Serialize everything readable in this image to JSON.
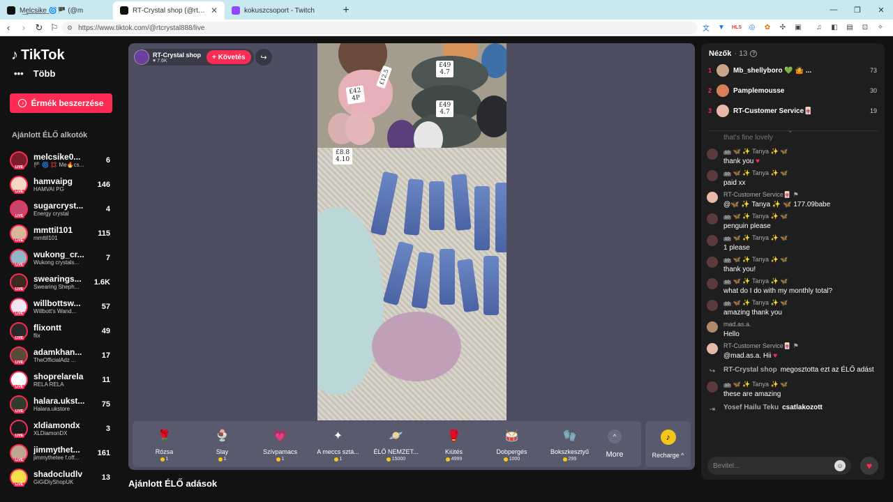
{
  "browser": {
    "tabs": [
      {
        "label": "M͟e͟l͟c͟s͟i͟k͟e͟ 🌀🏴 (@m",
        "color": "#111111",
        "active": false
      },
      {
        "label": "RT-Crystal shop (@rtcrystal88",
        "color": "#111111",
        "active": true
      },
      {
        "label": "kokuszcsoport - Twitch",
        "color": "#9146ff",
        "active": false
      }
    ],
    "new_tab": "+",
    "url": "https://www.tiktok.com/@rtcrystal888/live",
    "win_min": "—",
    "win_max": "❐",
    "win_close": "✕"
  },
  "sidebar": {
    "brand": "TikTok",
    "more_label": "Több",
    "more_icon": "•••",
    "coins_button": "Érmék beszerzése",
    "recommended_title": "Ajánlott ÉLŐ alkotók",
    "live_badge": "LIVE",
    "creators": [
      {
        "name": "melcsike0...",
        "sub": "🏴 🌀 💢 Me🔥cs...",
        "count": "6",
        "color": "#7a1d2e"
      },
      {
        "name": "hamvaipg",
        "sub": "HAMVAI PG",
        "count": "146",
        "color": "#f2d7c4"
      },
      {
        "name": "sugarcryst...",
        "sub": "Energy crystal",
        "count": "4",
        "color": "#c6466d"
      },
      {
        "name": "mmttil101",
        "sub": "mmttil101",
        "count": "115",
        "color": "#d9b69a"
      },
      {
        "name": "wukong_cr...",
        "sub": "Wukong crystals...",
        "count": "7",
        "color": "#8fb7c5"
      },
      {
        "name": "swearings...",
        "sub": "Swearing Sheph...",
        "count": "1.6K",
        "color": "#3b2a1d"
      },
      {
        "name": "willbottsw...",
        "sub": "Willbott's Wand...",
        "count": "57",
        "color": "#f0e7f5"
      },
      {
        "name": "flixontt",
        "sub": "flix",
        "count": "49",
        "color": "#2a2a2a"
      },
      {
        "name": "adamkhan...",
        "sub": "TheOfficialAdz ...",
        "count": "17",
        "color": "#5a4a3a"
      },
      {
        "name": "shoprelarela",
        "sub": "RELA RELA",
        "count": "11",
        "color": "#ffffff"
      },
      {
        "name": "halara.ukst...",
        "sub": "Halara.ukstore",
        "count": "75",
        "color": "#2e3d2f"
      },
      {
        "name": "xldiamondx",
        "sub": "XLDiamonDX",
        "count": "3",
        "color": "#1b1b1b"
      },
      {
        "name": "jimmythet...",
        "sub": "jimmythetee f.off...",
        "count": "161",
        "color": "#bda88f"
      },
      {
        "name": "shadocludlv",
        "sub": "GiGiDiyShopUK",
        "count": "13",
        "color": "#f4e04d"
      }
    ]
  },
  "player": {
    "streamer_name": "RT-Crystal shop",
    "streamer_likes": "♥ 7.6K",
    "follow_label": "+ Követés",
    "share_icon": "↪",
    "price_tags": [
      "£42\n4P",
      "£49\n4.7",
      "£49\n4.7",
      "£12.5",
      "£8.8\n4.10"
    ],
    "gifts": [
      {
        "name": "Rózsa",
        "price": "1",
        "icon": "🌹",
        "bg": "transparent"
      },
      {
        "name": "Slay",
        "price": "1",
        "icon": "🍨",
        "bg": "transparent"
      },
      {
        "name": "Szívpamacs",
        "price": "1",
        "icon": "💗",
        "bg": "transparent"
      },
      {
        "name": "A meccs sztá...",
        "price": "1",
        "icon": "✦",
        "bg": "transparent"
      },
      {
        "name": "ÉLŐ NEMZET...",
        "price": "15000",
        "icon": "🪐",
        "bg": "transparent"
      },
      {
        "name": "Kiütés",
        "price": "4999",
        "icon": "🥊",
        "bg": "transparent"
      },
      {
        "name": "Dobpergés",
        "price": "1000",
        "icon": "🥁",
        "bg": "transparent"
      },
      {
        "name": "Bokszkesztyű",
        "price": "299",
        "icon": "🧤",
        "bg": "transparent"
      }
    ],
    "more_label": "More",
    "more_icon": "^",
    "recharge_label": "Recharge ^",
    "recharge_icon": "♪"
  },
  "below_player_title": "Ajánlott ÉLŐ adások",
  "chat": {
    "viewers_title": "Nézők",
    "viewers_count": "· 13",
    "help_icon": "?",
    "chevron": "⌄",
    "viewers": [
      {
        "rank": "1",
        "name": "Mb_shellyboro 💚 🤷 ...",
        "score": "73",
        "color": "#c9a48a"
      },
      {
        "rank": "2",
        "name": "Pamplemousse",
        "score": "30",
        "color": "#d7805a"
      },
      {
        "rank": "3",
        "name": "RT-Customer Service🀄",
        "score": "19",
        "color": "#e8b9a8"
      }
    ],
    "faded_msg": "that's fine lovely",
    "messages": [
      {
        "user": "🦋 ✨ Tanya ✨ 🦋",
        "badge": "10",
        "text": "thank you",
        "heart": "♥",
        "color": "#5a3a3a"
      },
      {
        "user": "🦋 ✨ Tanya ✨ 🦋",
        "badge": "10",
        "text": "paid xx",
        "heart": "",
        "color": "#5a3a3a"
      },
      {
        "user": "RT-Customer Service🀄 ⚑",
        "badge": "",
        "text": "@🦋 ✨ Tanya ✨ 🦋 177.09babe",
        "heart": "",
        "color": "#e8b9a8"
      },
      {
        "user": "🦋 ✨ Tanya ✨ 🦋",
        "badge": "10",
        "text": "penguin please",
        "heart": "",
        "color": "#5a3a3a"
      },
      {
        "user": "🦋 ✨ Tanya ✨ 🦋",
        "badge": "10",
        "text": "1 please",
        "heart": "",
        "color": "#5a3a3a"
      },
      {
        "user": "🦋 ✨ Tanya ✨ 🦋",
        "badge": "10",
        "text": "thank you!",
        "heart": "",
        "color": "#5a3a3a"
      },
      {
        "user": "🦋 ✨ Tanya ✨ 🦋",
        "badge": "10",
        "text": "what do I do with my monthly total?",
        "heart": "",
        "color": "#5a3a3a"
      },
      {
        "user": "🦋 ✨ Tanya ✨ 🦋",
        "badge": "10",
        "text": "amazing thank you",
        "heart": "",
        "color": "#5a3a3a"
      },
      {
        "user": "mad.as.a.",
        "badge": "",
        "text": "Hello",
        "heart": "",
        "color": "#b08a6a"
      },
      {
        "user": "RT-Customer Service🀄 ⚑",
        "badge": "",
        "text": "@mad.as.a. Hii",
        "heart": "♥",
        "color": "#e8b9a8"
      }
    ],
    "share_event": {
      "user": "RT-Crystal shop",
      "text": "megosztotta ezt az ÉLŐ adást",
      "icon": "↪"
    },
    "last_message": {
      "user": "🦋 ✨ Tanya ✨ 🦋",
      "badge": "10",
      "text": "these are amazing",
      "color": "#5a3a3a"
    },
    "join_event": {
      "user": "Yosef Hailu Teku",
      "text": "csatlakozott",
      "icon": "⇥"
    },
    "input_placeholder": "Bevitel...",
    "emoji_icon": "☺",
    "heart_icon": "♥"
  }
}
